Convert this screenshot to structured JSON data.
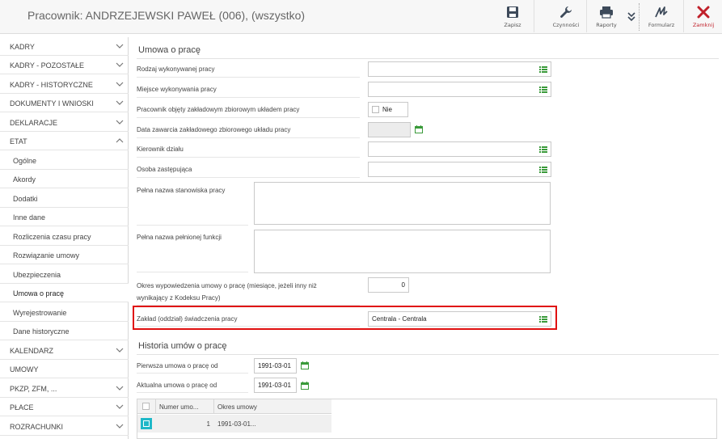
{
  "header": {
    "title": "Pracownik: ANDRZEJEWSKI PAWEŁ (006), (wszystko)",
    "tools": {
      "save": "Zapisz",
      "actions": "Czynności",
      "reports": "Raporty",
      "form": "Formularz",
      "close": "Zamknij"
    }
  },
  "sidebar": {
    "items": [
      {
        "label": "KADRY"
      },
      {
        "label": "KADRY - POZOSTAŁE"
      },
      {
        "label": "KADRY - HISTORYCZNE"
      },
      {
        "label": "DOKUMENTY I WNIOSKI"
      },
      {
        "label": "DEKLARACJE"
      },
      {
        "label": "ETAT"
      },
      {
        "label": "Ogólne"
      },
      {
        "label": "Akordy"
      },
      {
        "label": "Dodatki"
      },
      {
        "label": "Inne dane"
      },
      {
        "label": "Rozliczenia czasu pracy"
      },
      {
        "label": "Rozwiązanie umowy"
      },
      {
        "label": "Ubezpieczenia"
      },
      {
        "label": "Umowa o pracę"
      },
      {
        "label": "Wyrejestrowanie"
      },
      {
        "label": "Dane historyczne"
      },
      {
        "label": "KALENDARZ"
      },
      {
        "label": "UMOWY"
      },
      {
        "label": "PKZP, ZFM, ..."
      },
      {
        "label": "PŁACE"
      },
      {
        "label": "ROZRACHUNKI"
      }
    ]
  },
  "contract": {
    "title": "Umowa o pracę",
    "work_type_label": "Rodzaj wykonywanej pracy",
    "work_type_value": "",
    "work_place_label": "Miejsce wykonywania pracy",
    "work_place_value": "",
    "collective_label": "Pracownik objęty zakładowym zbiorowym układem pracy",
    "collective_value": "Nie",
    "collective_date_label": "Data zawarcia zakładowego zbiorowego układu pracy",
    "manager_label": "Kierownik działu",
    "substitute_label": "Osoba zastępująca",
    "position_full_label": "Pełna nazwa stanowiska pracy",
    "function_full_label": "Pełna nazwa pełnionej funkcji",
    "notice_label_1": "Okres wypowiedzenia umowy o pracę (miesiące, jeżeli inny niż",
    "notice_label_2": "wynikający z Kodeksu Pracy)",
    "notice_value": "0",
    "workplace_unit_label": "Zakład (oddział) świadczenia pracy",
    "workplace_unit_value": "Centrala - Centrala"
  },
  "history": {
    "title": "Historia umów o pracę",
    "first_label": "Pierwsza umowa o pracę od",
    "first_value": "1991-03-01",
    "current_label": "Aktualna umowa o pracę od",
    "current_value": "1991-03-01",
    "grid": {
      "columns": [
        "Numer umo...",
        "Okres umowy"
      ],
      "rows": [
        {
          "number": "1",
          "period": "1991-03-01..."
        }
      ]
    }
  },
  "colors": {
    "accent_teal": "#1eb8c8",
    "highlight_red": "#e01010",
    "icon_green": "#3a9a3a",
    "close_red": "#c0202a"
  }
}
